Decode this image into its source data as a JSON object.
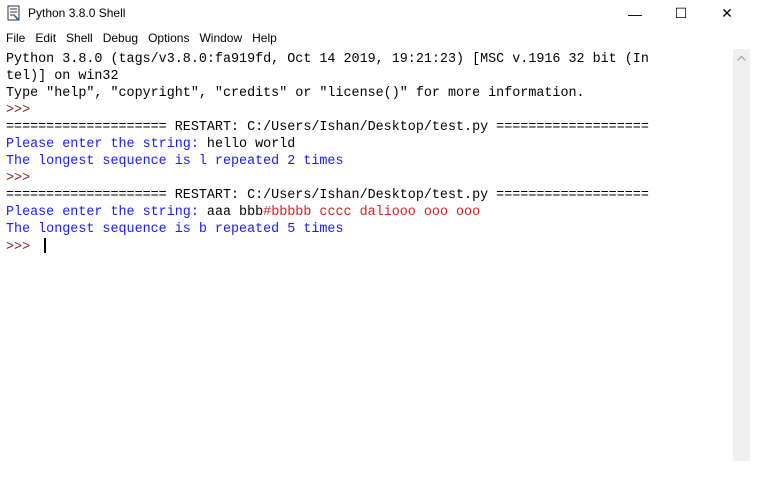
{
  "window": {
    "title": "Python 3.8.0 Shell",
    "minimize_glyph": "—",
    "maximize_glyph": "☐",
    "close_glyph": "✕"
  },
  "menu": [
    "File",
    "Edit",
    "Shell",
    "Debug",
    "Options",
    "Window",
    "Help"
  ],
  "shell": {
    "banner1": "Python 3.8.0 (tags/v3.8.0:fa919fd, Oct 14 2019, 19:21:23) [MSC v.1916 32 bit (In",
    "banner2": "tel)] on win32",
    "banner3": "Type \"help\", \"copyright\", \"credits\" or \"license()\" for more information.",
    "prompt": ">>> ",
    "restart1": "==================== RESTART: C:/Users/Ishan/Desktop/test.py ===================",
    "out1_prefix": "Please enter the string: ",
    "out1_input": "hello world",
    "out2": "The longest sequence is l repeated 2 times",
    "restart2": "==================== RESTART: C:/Users/Ishan/Desktop/test.py ===================",
    "out3_prefix": "Please enter the string: ",
    "out3_input_black": "aaa bbb",
    "out3_input_red": "#bbbbb cccc dalio​oo ooo ooo",
    "out4": "The longest sequence is b repeated 5 times"
  },
  "colors": {
    "stdout": "#1a1aff",
    "stderr_red": "#e02020",
    "prompt": "#8b1a1a"
  }
}
